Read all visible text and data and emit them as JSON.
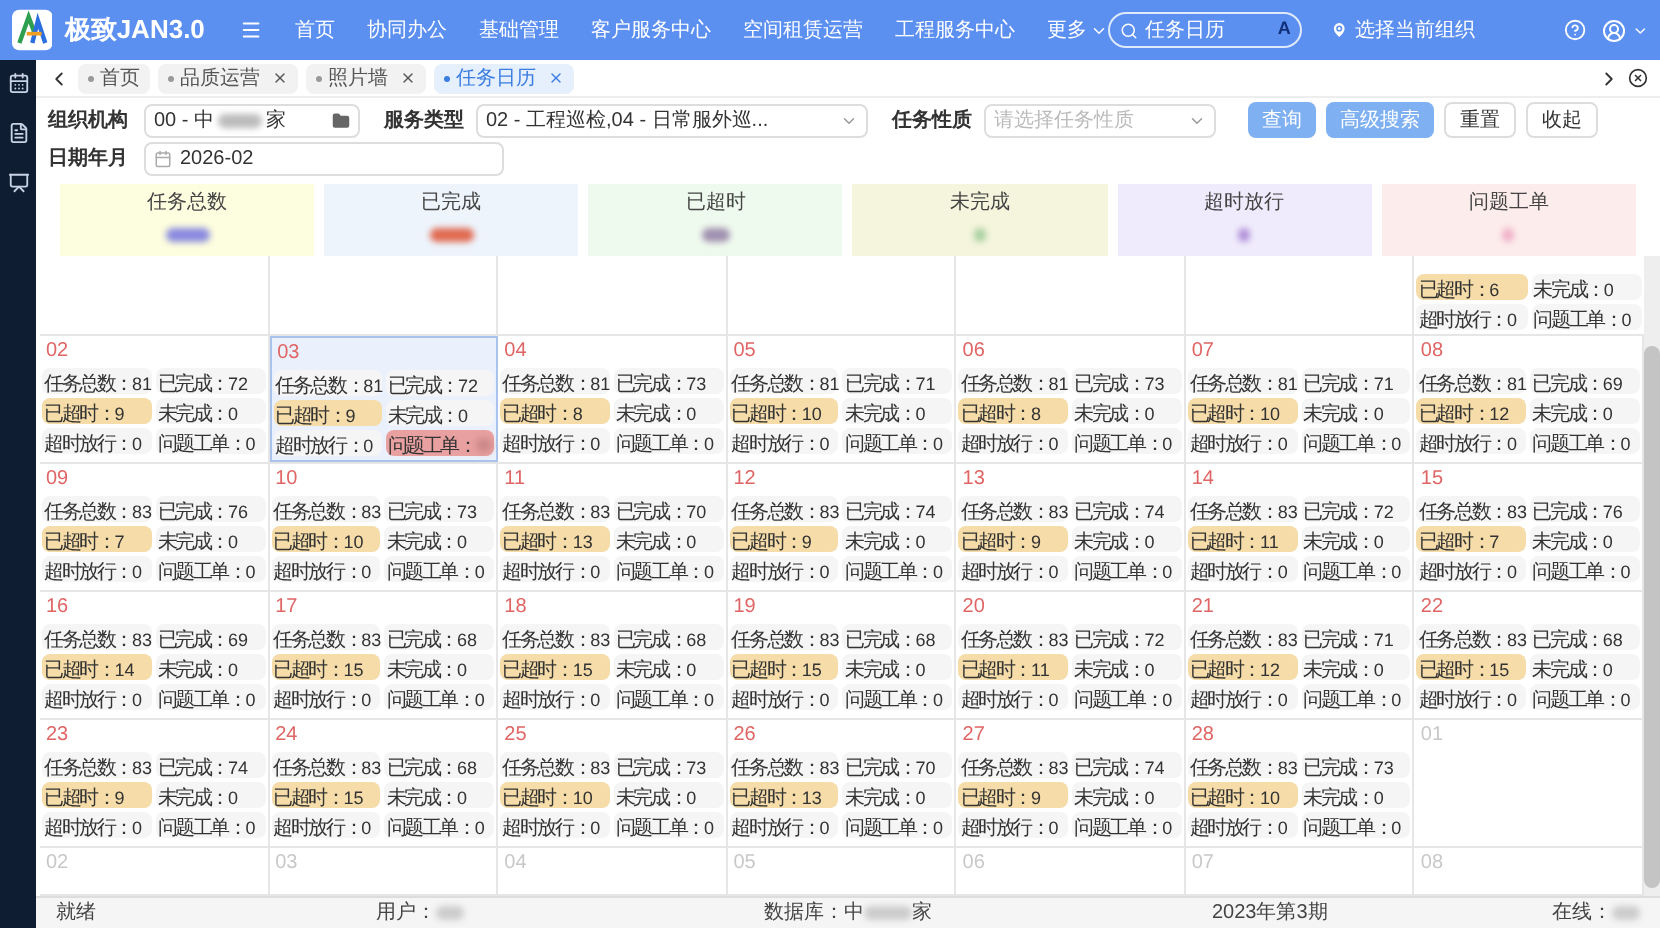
{
  "app": {
    "title": "极致JAN3.0"
  },
  "nav": {
    "items": [
      "首页",
      "协同办公",
      "基础管理",
      "客户服务中心",
      "空间租赁运营",
      "工程服务中心"
    ],
    "more": "更多",
    "search": {
      "value": "任务日历"
    },
    "search_badge": "A",
    "location": "选择当前组织"
  },
  "tabs": [
    {
      "label": "首页",
      "selected": false,
      "closable": false
    },
    {
      "label": "品质运营",
      "selected": false,
      "closable": true
    },
    {
      "label": "照片墙",
      "selected": false,
      "closable": true
    },
    {
      "label": "任务日历",
      "selected": true,
      "closable": true
    }
  ],
  "filters": {
    "org_label": "组织机构",
    "org_value_start": "00 - 中",
    "org_value_end": "家",
    "service_label": "服务类型",
    "service_value": "02 - 工程巡检,04 - 日常服外巡...",
    "nature_label": "任务性质",
    "nature_placeholder": "请选择任务性质",
    "date_label": "日期年月",
    "date_value": "2026-02",
    "buttons": [
      {
        "label": "查询",
        "kind": "primary"
      },
      {
        "label": "高级搜索",
        "kind": "primary"
      },
      {
        "label": "重置",
        "kind": "plain"
      },
      {
        "label": "收起",
        "kind": "plain"
      }
    ]
  },
  "summary": [
    {
      "title": "任务总数",
      "color": "#fdfddf"
    },
    {
      "title": "已完成",
      "color": "#eef4fc"
    },
    {
      "title": "已超时",
      "color": "#effaee"
    },
    {
      "title": "未完成",
      "color": "#f4f5dc"
    },
    {
      "title": "超时放行",
      "color": "#f0ebfc"
    },
    {
      "title": "问题工单",
      "color": "#fcecec"
    }
  ],
  "calendar": {
    "partial_stats": [
      {
        "label": "已超时：",
        "value": "6",
        "kind": "overdue"
      },
      {
        "label": "未完成：",
        "value": "0",
        "kind": "plain"
      },
      {
        "label": "超时放行：",
        "value": "0",
        "kind": "plain"
      },
      {
        "label": "问题工单：",
        "value": "0",
        "kind": "plain"
      }
    ],
    "weeks": [
      [
        {
          "day": "02",
          "in_month": true,
          "selected": false,
          "stats": [
            {
              "label": "任务总数：",
              "value": "81",
              "kind": "plain"
            },
            {
              "label": "已完成：",
              "value": "72",
              "kind": "plain"
            },
            {
              "label": "已超时：",
              "value": "9",
              "kind": "overdue"
            },
            {
              "label": "未完成：",
              "value": "0",
              "kind": "plain"
            },
            {
              "label": "超时放行：",
              "value": "0",
              "kind": "plain"
            },
            {
              "label": "问题工单：",
              "value": "0",
              "kind": "plain"
            }
          ]
        },
        {
          "day": "03",
          "in_month": true,
          "selected": true,
          "stats": [
            {
              "label": "任务总数：",
              "value": "81",
              "kind": "plain"
            },
            {
              "label": "已完成：",
              "value": "72",
              "kind": "plain"
            },
            {
              "label": "已超时：",
              "value": "9",
              "kind": "overdue"
            },
            {
              "label": "未完成：",
              "value": "0",
              "kind": "plain"
            },
            {
              "label": "超时放行：",
              "value": "0",
              "kind": "plain"
            },
            {
              "label": "问题工单：",
              "kind": "alert"
            }
          ]
        },
        {
          "day": "04",
          "in_month": true,
          "selected": false,
          "stats": [
            {
              "label": "任务总数：",
              "value": "81",
              "kind": "plain"
            },
            {
              "label": "已完成：",
              "value": "73",
              "kind": "plain"
            },
            {
              "label": "已超时：",
              "value": "8",
              "kind": "overdue"
            },
            {
              "label": "未完成：",
              "value": "0",
              "kind": "plain"
            },
            {
              "label": "超时放行：",
              "value": "0",
              "kind": "plain"
            },
            {
              "label": "问题工单：",
              "value": "0",
              "kind": "plain"
            }
          ]
        },
        {
          "day": "05",
          "in_month": true,
          "selected": false,
          "stats": [
            {
              "label": "任务总数：",
              "value": "81",
              "kind": "plain"
            },
            {
              "label": "已完成：",
              "value": "71",
              "kind": "plain"
            },
            {
              "label": "已超时：",
              "value": "10",
              "kind": "overdue"
            },
            {
              "label": "未完成：",
              "value": "0",
              "kind": "plain"
            },
            {
              "label": "超时放行：",
              "value": "0",
              "kind": "plain"
            },
            {
              "label": "问题工单：",
              "value": "0",
              "kind": "plain"
            }
          ]
        },
        {
          "day": "06",
          "in_month": true,
          "selected": false,
          "stats": [
            {
              "label": "任务总数：",
              "value": "81",
              "kind": "plain"
            },
            {
              "label": "已完成：",
              "value": "73",
              "kind": "plain"
            },
            {
              "label": "已超时：",
              "value": "8",
              "kind": "overdue"
            },
            {
              "label": "未完成：",
              "value": "0",
              "kind": "plain"
            },
            {
              "label": "超时放行：",
              "value": "0",
              "kind": "plain"
            },
            {
              "label": "问题工单：",
              "value": "0",
              "kind": "plain"
            }
          ]
        },
        {
          "day": "07",
          "in_month": true,
          "selected": false,
          "stats": [
            {
              "label": "任务总数：",
              "value": "81",
              "kind": "plain"
            },
            {
              "label": "已完成：",
              "value": "71",
              "kind": "plain"
            },
            {
              "label": "已超时：",
              "value": "10",
              "kind": "overdue"
            },
            {
              "label": "未完成：",
              "value": "0",
              "kind": "plain"
            },
            {
              "label": "超时放行：",
              "value": "0",
              "kind": "plain"
            },
            {
              "label": "问题工单：",
              "value": "0",
              "kind": "plain"
            }
          ]
        },
        {
          "day": "08",
          "in_month": true,
          "selected": false,
          "stats": [
            {
              "label": "任务总数：",
              "value": "81",
              "kind": "plain"
            },
            {
              "label": "已完成：",
              "value": "69",
              "kind": "plain"
            },
            {
              "label": "已超时：",
              "value": "12",
              "kind": "overdue"
            },
            {
              "label": "未完成：",
              "value": "0",
              "kind": "plain"
            },
            {
              "label": "超时放行：",
              "value": "0",
              "kind": "plain"
            },
            {
              "label": "问题工单：",
              "value": "0",
              "kind": "plain"
            }
          ]
        }
      ],
      [
        {
          "day": "09",
          "in_month": true,
          "selected": false,
          "stats": [
            {
              "label": "任务总数：",
              "value": "83",
              "kind": "plain"
            },
            {
              "label": "已完成：",
              "value": "76",
              "kind": "plain"
            },
            {
              "label": "已超时：",
              "value": "7",
              "kind": "overdue"
            },
            {
              "label": "未完成：",
              "value": "0",
              "kind": "plain"
            },
            {
              "label": "超时放行：",
              "value": "0",
              "kind": "plain"
            },
            {
              "label": "问题工单：",
              "value": "0",
              "kind": "plain"
            }
          ]
        },
        {
          "day": "10",
          "in_month": true,
          "selected": false,
          "stats": [
            {
              "label": "任务总数：",
              "value": "83",
              "kind": "plain"
            },
            {
              "label": "已完成：",
              "value": "73",
              "kind": "plain"
            },
            {
              "label": "已超时：",
              "value": "10",
              "kind": "overdue"
            },
            {
              "label": "未完成：",
              "value": "0",
              "kind": "plain"
            },
            {
              "label": "超时放行：",
              "value": "0",
              "kind": "plain"
            },
            {
              "label": "问题工单：",
              "value": "0",
              "kind": "plain"
            }
          ]
        },
        {
          "day": "11",
          "in_month": true,
          "selected": false,
          "stats": [
            {
              "label": "任务总数：",
              "value": "83",
              "kind": "plain"
            },
            {
              "label": "已完成：",
              "value": "70",
              "kind": "plain"
            },
            {
              "label": "已超时：",
              "value": "13",
              "kind": "overdue"
            },
            {
              "label": "未完成：",
              "value": "0",
              "kind": "plain"
            },
            {
              "label": "超时放行：",
              "value": "0",
              "kind": "plain"
            },
            {
              "label": "问题工单：",
              "value": "0",
              "kind": "plain"
            }
          ]
        },
        {
          "day": "12",
          "in_month": true,
          "selected": false,
          "stats": [
            {
              "label": "任务总数：",
              "value": "83",
              "kind": "plain"
            },
            {
              "label": "已完成：",
              "value": "74",
              "kind": "plain"
            },
            {
              "label": "已超时：",
              "value": "9",
              "kind": "overdue"
            },
            {
              "label": "未完成：",
              "value": "0",
              "kind": "plain"
            },
            {
              "label": "超时放行：",
              "value": "0",
              "kind": "plain"
            },
            {
              "label": "问题工单：",
              "value": "0",
              "kind": "plain"
            }
          ]
        },
        {
          "day": "13",
          "in_month": true,
          "selected": false,
          "stats": [
            {
              "label": "任务总数：",
              "value": "83",
              "kind": "plain"
            },
            {
              "label": "已完成：",
              "value": "74",
              "kind": "plain"
            },
            {
              "label": "已超时：",
              "value": "9",
              "kind": "overdue"
            },
            {
              "label": "未完成：",
              "value": "0",
              "kind": "plain"
            },
            {
              "label": "超时放行：",
              "value": "0",
              "kind": "plain"
            },
            {
              "label": "问题工单：",
              "value": "0",
              "kind": "plain"
            }
          ]
        },
        {
          "day": "14",
          "in_month": true,
          "selected": false,
          "stats": [
            {
              "label": "任务总数：",
              "value": "83",
              "kind": "plain"
            },
            {
              "label": "已完成：",
              "value": "72",
              "kind": "plain"
            },
            {
              "label": "已超时：",
              "value": "11",
              "kind": "overdue"
            },
            {
              "label": "未完成：",
              "value": "0",
              "kind": "plain"
            },
            {
              "label": "超时放行：",
              "value": "0",
              "kind": "plain"
            },
            {
              "label": "问题工单：",
              "value": "0",
              "kind": "plain"
            }
          ]
        },
        {
          "day": "15",
          "in_month": true,
          "selected": false,
          "stats": [
            {
              "label": "任务总数：",
              "value": "83",
              "kind": "plain"
            },
            {
              "label": "已完成：",
              "value": "76",
              "kind": "plain"
            },
            {
              "label": "已超时：",
              "value": "7",
              "kind": "overdue"
            },
            {
              "label": "未完成：",
              "value": "0",
              "kind": "plain"
            },
            {
              "label": "超时放行：",
              "value": "0",
              "kind": "plain"
            },
            {
              "label": "问题工单：",
              "value": "0",
              "kind": "plain"
            }
          ]
        }
      ],
      [
        {
          "day": "16",
          "in_month": true,
          "selected": false,
          "stats": [
            {
              "label": "任务总数：",
              "value": "83",
              "kind": "plain"
            },
            {
              "label": "已完成：",
              "value": "69",
              "kind": "plain"
            },
            {
              "label": "已超时：",
              "value": "14",
              "kind": "overdue"
            },
            {
              "label": "未完成：",
              "value": "0",
              "kind": "plain"
            },
            {
              "label": "超时放行：",
              "value": "0",
              "kind": "plain"
            },
            {
              "label": "问题工单：",
              "value": "0",
              "kind": "plain"
            }
          ]
        },
        {
          "day": "17",
          "in_month": true,
          "selected": false,
          "stats": [
            {
              "label": "任务总数：",
              "value": "83",
              "kind": "plain"
            },
            {
              "label": "已完成：",
              "value": "68",
              "kind": "plain"
            },
            {
              "label": "已超时：",
              "value": "15",
              "kind": "overdue"
            },
            {
              "label": "未完成：",
              "value": "0",
              "kind": "plain"
            },
            {
              "label": "超时放行：",
              "value": "0",
              "kind": "plain"
            },
            {
              "label": "问题工单：",
              "value": "0",
              "kind": "plain"
            }
          ]
        },
        {
          "day": "18",
          "in_month": true,
          "selected": false,
          "stats": [
            {
              "label": "任务总数：",
              "value": "83",
              "kind": "plain"
            },
            {
              "label": "已完成：",
              "value": "68",
              "kind": "plain"
            },
            {
              "label": "已超时：",
              "value": "15",
              "kind": "overdue"
            },
            {
              "label": "未完成：",
              "value": "0",
              "kind": "plain"
            },
            {
              "label": "超时放行：",
              "value": "0",
              "kind": "plain"
            },
            {
              "label": "问题工单：",
              "value": "0",
              "kind": "plain"
            }
          ]
        },
        {
          "day": "19",
          "in_month": true,
          "selected": false,
          "stats": [
            {
              "label": "任务总数：",
              "value": "83",
              "kind": "plain"
            },
            {
              "label": "已完成：",
              "value": "68",
              "kind": "plain"
            },
            {
              "label": "已超时：",
              "value": "15",
              "kind": "overdue"
            },
            {
              "label": "未完成：",
              "value": "0",
              "kind": "plain"
            },
            {
              "label": "超时放行：",
              "value": "0",
              "kind": "plain"
            },
            {
              "label": "问题工单：",
              "value": "0",
              "kind": "plain"
            }
          ]
        },
        {
          "day": "20",
          "in_month": true,
          "selected": false,
          "stats": [
            {
              "label": "任务总数：",
              "value": "83",
              "kind": "plain"
            },
            {
              "label": "已完成：",
              "value": "72",
              "kind": "plain"
            },
            {
              "label": "已超时：",
              "value": "11",
              "kind": "overdue"
            },
            {
              "label": "未完成：",
              "value": "0",
              "kind": "plain"
            },
            {
              "label": "超时放行：",
              "value": "0",
              "kind": "plain"
            },
            {
              "label": "问题工单：",
              "value": "0",
              "kind": "plain"
            }
          ]
        },
        {
          "day": "21",
          "in_month": true,
          "selected": false,
          "stats": [
            {
              "label": "任务总数：",
              "value": "83",
              "kind": "plain"
            },
            {
              "label": "已完成：",
              "value": "71",
              "kind": "plain"
            },
            {
              "label": "已超时：",
              "value": "12",
              "kind": "overdue"
            },
            {
              "label": "未完成：",
              "value": "0",
              "kind": "plain"
            },
            {
              "label": "超时放行：",
              "value": "0",
              "kind": "plain"
            },
            {
              "label": "问题工单：",
              "value": "0",
              "kind": "plain"
            }
          ]
        },
        {
          "day": "22",
          "in_month": true,
          "selected": false,
          "stats": [
            {
              "label": "任务总数：",
              "value": "83",
              "kind": "plain"
            },
            {
              "label": "已完成：",
              "value": "68",
              "kind": "plain"
            },
            {
              "label": "已超时：",
              "value": "15",
              "kind": "overdue"
            },
            {
              "label": "未完成：",
              "value": "0",
              "kind": "plain"
            },
            {
              "label": "超时放行：",
              "value": "0",
              "kind": "plain"
            },
            {
              "label": "问题工单：",
              "value": "0",
              "kind": "plain"
            }
          ]
        }
      ],
      [
        {
          "day": "23",
          "in_month": true,
          "selected": false,
          "stats": [
            {
              "label": "任务总数：",
              "value": "83",
              "kind": "plain"
            },
            {
              "label": "已完成：",
              "value": "74",
              "kind": "plain"
            },
            {
              "label": "已超时：",
              "value": "9",
              "kind": "overdue"
            },
            {
              "label": "未完成：",
              "value": "0",
              "kind": "plain"
            },
            {
              "label": "超时放行：",
              "value": "0",
              "kind": "plain"
            },
            {
              "label": "问题工单：",
              "value": "0",
              "kind": "plain"
            }
          ]
        },
        {
          "day": "24",
          "in_month": true,
          "selected": false,
          "stats": [
            {
              "label": "任务总数：",
              "value": "83",
              "kind": "plain"
            },
            {
              "label": "已完成：",
              "value": "68",
              "kind": "plain"
            },
            {
              "label": "已超时：",
              "value": "15",
              "kind": "overdue"
            },
            {
              "label": "未完成：",
              "value": "0",
              "kind": "plain"
            },
            {
              "label": "超时放行：",
              "value": "0",
              "kind": "plain"
            },
            {
              "label": "问题工单：",
              "value": "0",
              "kind": "plain"
            }
          ]
        },
        {
          "day": "25",
          "in_month": true,
          "selected": false,
          "stats": [
            {
              "label": "任务总数：",
              "value": "83",
              "kind": "plain"
            },
            {
              "label": "已完成：",
              "value": "73",
              "kind": "plain"
            },
            {
              "label": "已超时：",
              "value": "10",
              "kind": "overdue"
            },
            {
              "label": "未完成：",
              "value": "0",
              "kind": "plain"
            },
            {
              "label": "超时放行：",
              "value": "0",
              "kind": "plain"
            },
            {
              "label": "问题工单：",
              "value": "0",
              "kind": "plain"
            }
          ]
        },
        {
          "day": "26",
          "in_month": true,
          "selected": false,
          "stats": [
            {
              "label": "任务总数：",
              "value": "83",
              "kind": "plain"
            },
            {
              "label": "已完成：",
              "value": "70",
              "kind": "plain"
            },
            {
              "label": "已超时：",
              "value": "13",
              "kind": "overdue"
            },
            {
              "label": "未完成：",
              "value": "0",
              "kind": "plain"
            },
            {
              "label": "超时放行：",
              "value": "0",
              "kind": "plain"
            },
            {
              "label": "问题工单：",
              "value": "0",
              "kind": "plain"
            }
          ]
        },
        {
          "day": "27",
          "in_month": true,
          "selected": false,
          "stats": [
            {
              "label": "任务总数：",
              "value": "83",
              "kind": "plain"
            },
            {
              "label": "已完成：",
              "value": "74",
              "kind": "plain"
            },
            {
              "label": "已超时：",
              "value": "9",
              "kind": "overdue"
            },
            {
              "label": "未完成：",
              "value": "0",
              "kind": "plain"
            },
            {
              "label": "超时放行：",
              "value": "0",
              "kind": "plain"
            },
            {
              "label": "问题工单：",
              "value": "0",
              "kind": "plain"
            }
          ]
        },
        {
          "day": "28",
          "in_month": true,
          "selected": false,
          "stats": [
            {
              "label": "任务总数：",
              "value": "83",
              "kind": "plain"
            },
            {
              "label": "已完成：",
              "value": "73",
              "kind": "plain"
            },
            {
              "label": "已超时：",
              "value": "10",
              "kind": "overdue"
            },
            {
              "label": "未完成：",
              "value": "0",
              "kind": "plain"
            },
            {
              "label": "超时放行：",
              "value": "0",
              "kind": "plain"
            },
            {
              "label": "问题工单：",
              "value": "0",
              "kind": "plain"
            }
          ]
        },
        {
          "day": "01",
          "in_month": false,
          "selected": false
        }
      ],
      [
        {
          "day": "02",
          "in_month": false,
          "selected": false
        },
        {
          "day": "03",
          "in_month": false,
          "selected": false
        },
        {
          "day": "04",
          "in_month": false,
          "selected": false
        },
        {
          "day": "05",
          "in_month": false,
          "selected": false
        },
        {
          "day": "06",
          "in_month": false,
          "selected": false
        },
        {
          "day": "07",
          "in_month": false,
          "selected": false
        },
        {
          "day": "08",
          "in_month": false,
          "selected": false
        }
      ]
    ]
  },
  "status_bar": {
    "state": "就绪",
    "user_label": "用户：",
    "db_label_start": "数据库：中",
    "db_label_end": "家",
    "period": "2023年第3期",
    "online_label": "在线："
  }
}
